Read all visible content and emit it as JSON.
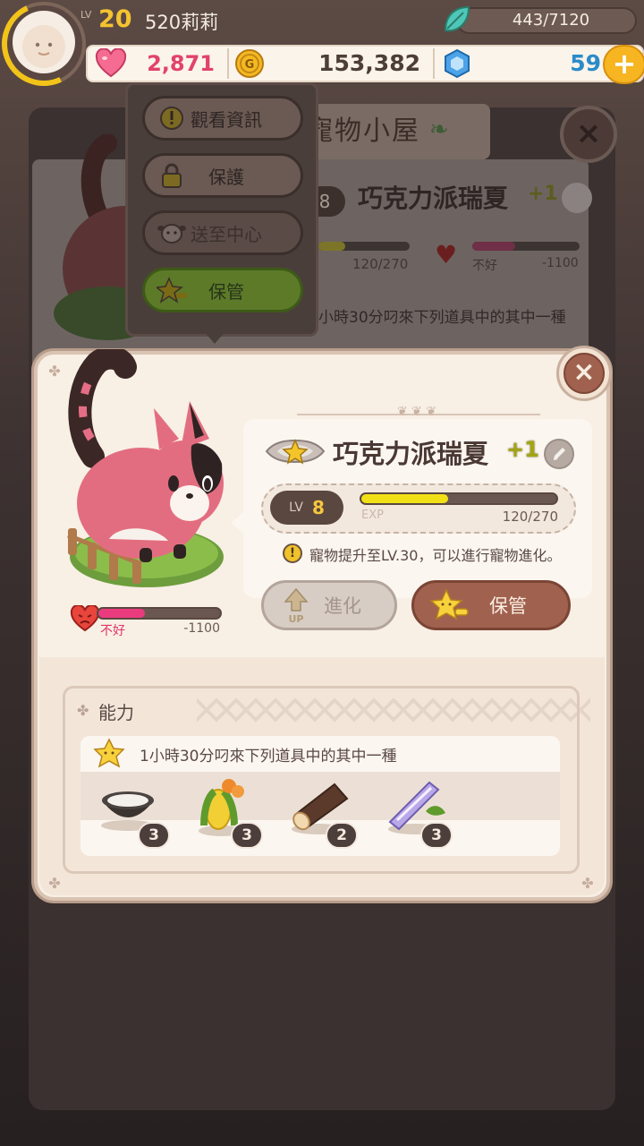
{
  "hud": {
    "level_label": "LV",
    "level": "20",
    "player_name": "520莉莉",
    "energy": "443/7120",
    "hearts": "2,871",
    "coins": "153,382",
    "gems": "59",
    "add_label": "+"
  },
  "background": {
    "window_title": "寵物小屋",
    "pet_name": "巧克力派瑞夏",
    "pet_plus": "+1",
    "level": "8",
    "exp": "120/270",
    "mood_label": "不好",
    "mood_value": "-1100",
    "ability_desc": "小時30分叼來下列道具中的其中一種",
    "close_label": "×"
  },
  "popup_menu": {
    "items": [
      {
        "label": "觀看資訊",
        "icon": "info-icon"
      },
      {
        "label": "保護",
        "icon": "lock-icon"
      },
      {
        "label": "送至中心",
        "icon": "cow-icon"
      },
      {
        "label": "保管",
        "icon": "star-keep-icon"
      }
    ]
  },
  "pet_card": {
    "close_label": "×",
    "name": "巧克力派瑞夏",
    "plus": "+1",
    "level_label": "LV",
    "level": "8",
    "exp_label": "EXP",
    "exp_value": "120/270",
    "exp_fraction": 0.444,
    "hint_icon": "!",
    "hint": "寵物提升至LV.30，可以進行寵物進化。",
    "evolve_label": "進化",
    "up_label": "UP",
    "keep_label": "保管",
    "mood_label": "不好",
    "mood_value": "-1100",
    "mood_fraction": 0.38,
    "ability": {
      "title": "能力",
      "desc": "1小時30分叼來下列道具中的其中一種",
      "items": [
        {
          "name": "milk-bowl-icon",
          "count": "3"
        },
        {
          "name": "corn-icon",
          "count": "3"
        },
        {
          "name": "wood-log-icon",
          "count": "2"
        },
        {
          "name": "crystal-stick-icon",
          "count": "3"
        }
      ]
    }
  },
  "colors": {
    "accent_brown": "#a0624f",
    "gold": "#f4c330",
    "exp_yellow": "#f2e017",
    "mood_pink": "#ea3b7e",
    "gem_blue": "#2b8bc9",
    "heart_pink": "#e2426c"
  }
}
